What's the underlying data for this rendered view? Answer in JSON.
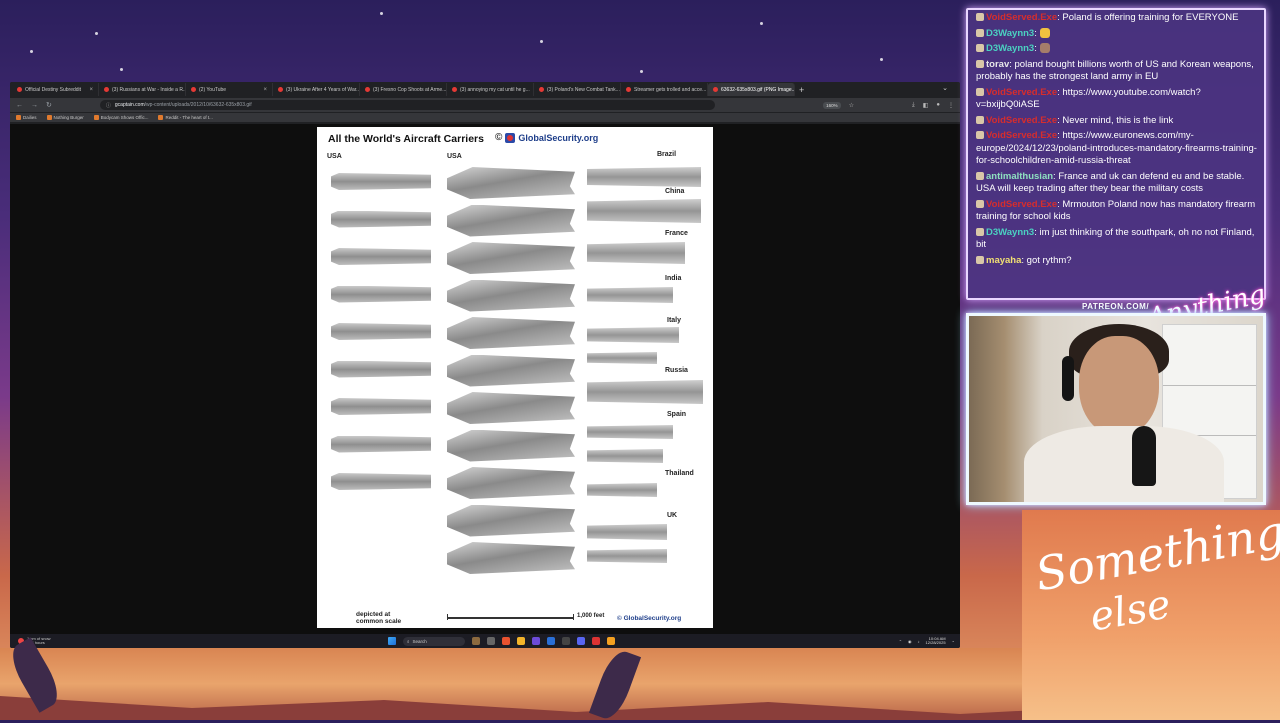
{
  "browser": {
    "tabs": [
      {
        "label": "Official Destiny Subreddit",
        "active": false
      },
      {
        "label": "(3) Russians at War - Inside a R...",
        "active": false
      },
      {
        "label": "(2) YouTube",
        "active": false
      },
      {
        "label": "(3) Ukraine After 4 Years of War...",
        "active": false
      },
      {
        "label": "(3) Fresno Cop Shoots at Arme...",
        "active": false
      },
      {
        "label": "(3) annoying my cat until he g...",
        "active": false
      },
      {
        "label": "(3) Poland's New Combat Tank...",
        "active": false
      },
      {
        "label": "Streamer gets trolled and acce...",
        "active": false
      },
      {
        "label": "63632-635x803.gif (PNG Image...",
        "active": true
      }
    ],
    "url_host": "gcaptain.com",
    "url_path": "/wp-content/uploads/2012/10/63632-635x803.gif",
    "zoom": "160%",
    "bookmarks": [
      "Dailies",
      "Nothing Burger",
      "Bodycam Shows Offic...",
      "Reddit - The heart of t..."
    ]
  },
  "image": {
    "title": "All the World's Aircraft Carriers",
    "logo_text": "GlobalSecurity.org",
    "columns": [
      "USA",
      "USA"
    ],
    "countries": [
      "Brazil",
      "China",
      "France",
      "India",
      "Italy",
      "Russia",
      "Spain",
      "Thailand",
      "UK"
    ],
    "scale_label": "depicted at common scale",
    "scale_value": "1,000 feet",
    "footer_logo": "GlobalSecurity.org"
  },
  "taskbar": {
    "weather_line1": "1 cm of snow",
    "weather_line2": "In 4 hours",
    "search": "Search",
    "time": "10:04 AM",
    "date": "12/28/2025"
  },
  "chat": [
    {
      "user": "VoidServed.Exe",
      "color": "red",
      "text": "Poland is offering training for EVERYONE"
    },
    {
      "user": "D3Waynn3",
      "color": "teal",
      "text": "",
      "emote": "#f0c040"
    },
    {
      "user": "D3Waynn3",
      "color": "teal",
      "text": "",
      "emote": "#a57d6a"
    },
    {
      "user": "torav",
      "color": "white",
      "text": "poland bought billions worth of US and Korean weapons, probably has the strongest land army in EU"
    },
    {
      "user": "VoidServed.Exe",
      "color": "red",
      "text": "https://www.youtube.com/watch?v=bxijbQ0iASE"
    },
    {
      "user": "VoidServed.Exe",
      "color": "red",
      "text": "Never mind, this is the link"
    },
    {
      "user": "VoidServed.Exe",
      "color": "red",
      "text": "https://www.euronews.com/my-europe/2024/12/23/poland-introduces-mandatory-firearms-training-for-schoolchildren-amid-russia-threat"
    },
    {
      "user": "antimalthusian",
      "color": "mint",
      "text": "France and uk can defend eu and be stable. USA will keep trading after they bear the military costs"
    },
    {
      "user": "VoidServed.Exe",
      "color": "red",
      "text": "Mrmouton Poland now has mandatory firearm training for school kids"
    },
    {
      "user": "D3Waynn3",
      "color": "teal",
      "text": "im just thinking of the southpark, oh no not Finland, bit"
    },
    {
      "user": "mayaha",
      "color": "yellow",
      "text": "got rythm?"
    }
  ],
  "overlay": {
    "patreon": "PATREON.COM/",
    "patreon_name": "Anything else",
    "brand_line1": "Something",
    "brand_line2": "else"
  }
}
